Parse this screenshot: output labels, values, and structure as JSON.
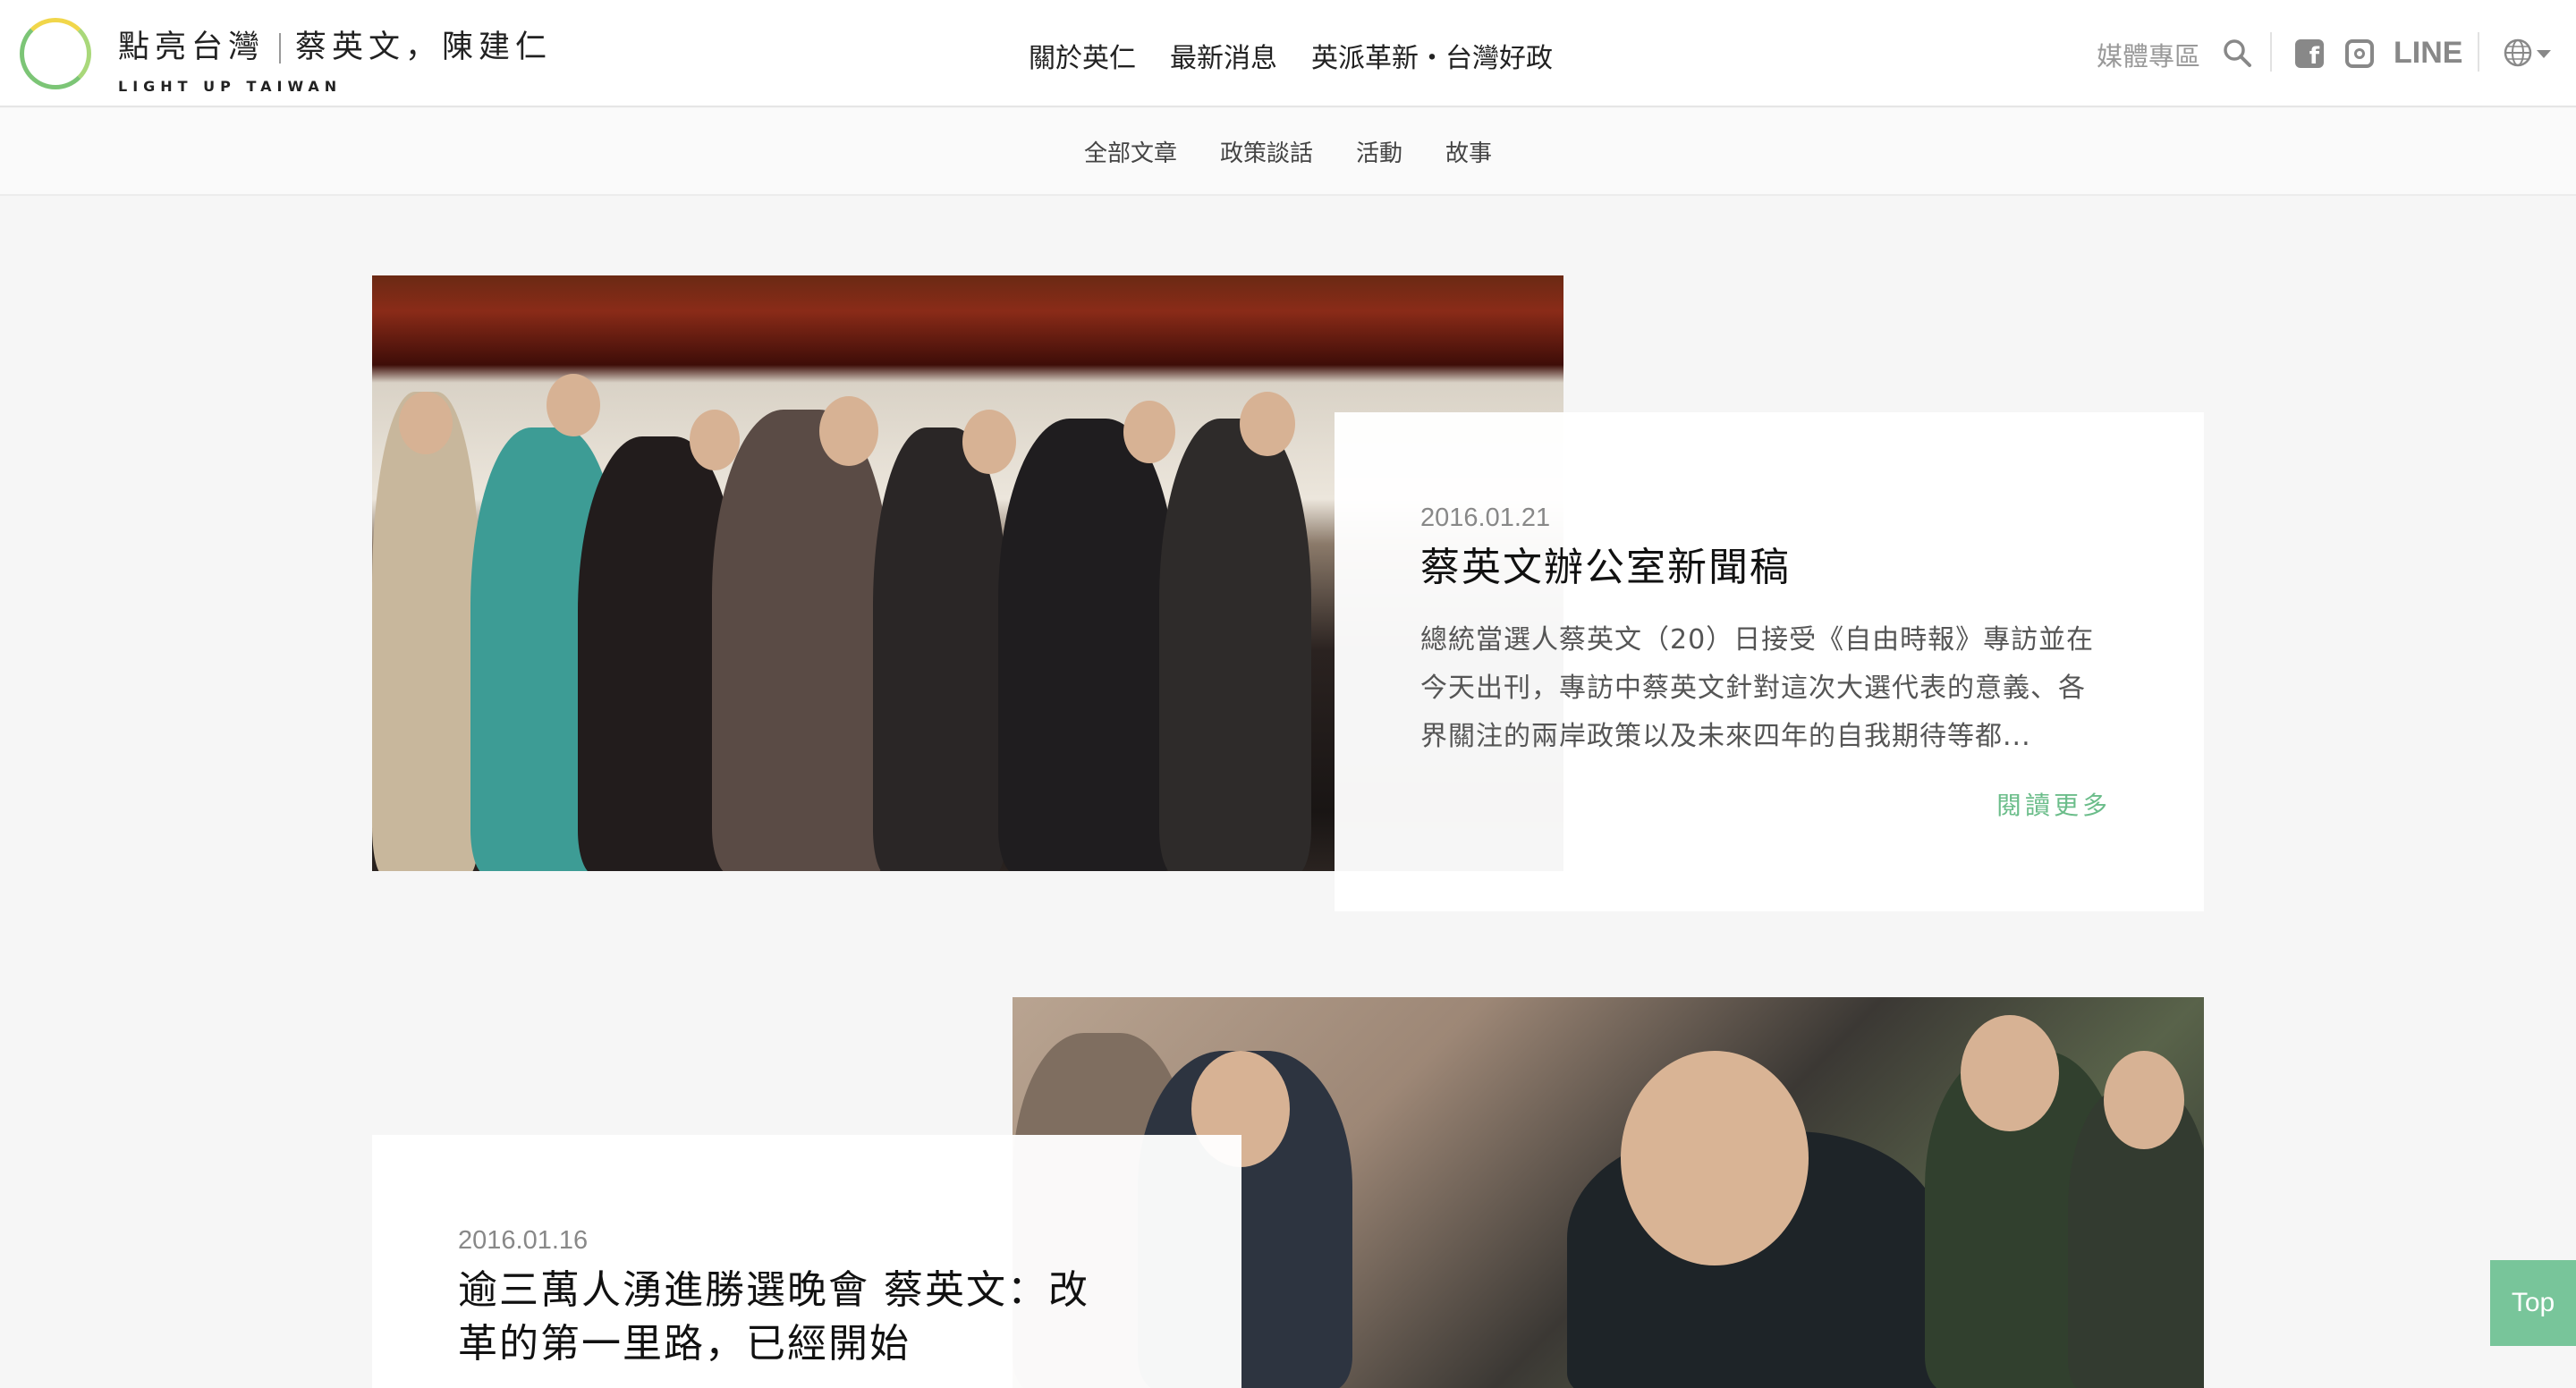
{
  "header": {
    "logo_title_1": "點亮台灣",
    "logo_title_2": "蔡英文，陳建仁",
    "logo_subtitle": "LIGHT UP TAIWAN",
    "nav": [
      "關於英仁",
      "最新消息",
      "英派革新・台灣好政"
    ],
    "media_label": "媒體專區",
    "line_label": "LINE",
    "icons": [
      "search-icon",
      "facebook-icon",
      "instagram-icon",
      "globe-icon"
    ]
  },
  "subnav": [
    "全部文章",
    "政策談話",
    "活動",
    "故事"
  ],
  "articles": [
    {
      "date": "2016.01.21",
      "title": "蔡英文辦公室新聞稿",
      "excerpt_lines": [
        "總統當選人蔡英文（20）日接受《自由時報》專訪並在",
        "今天出刊，專訪中蔡英文針對這次大選代表的意義、各",
        "界關注的兩岸政策以及未來四年的自我期待等都..."
      ],
      "read_more": "閱讀更多"
    },
    {
      "date": "2016.01.16",
      "title_lines": [
        "逾三萬人湧進勝選晚會 蔡英文：改",
        "革的第一里路，已經開始"
      ]
    }
  ],
  "top_button": "Top",
  "colors": {
    "accent": "#6bbd8a",
    "top_button_bg": "#78c59a"
  }
}
